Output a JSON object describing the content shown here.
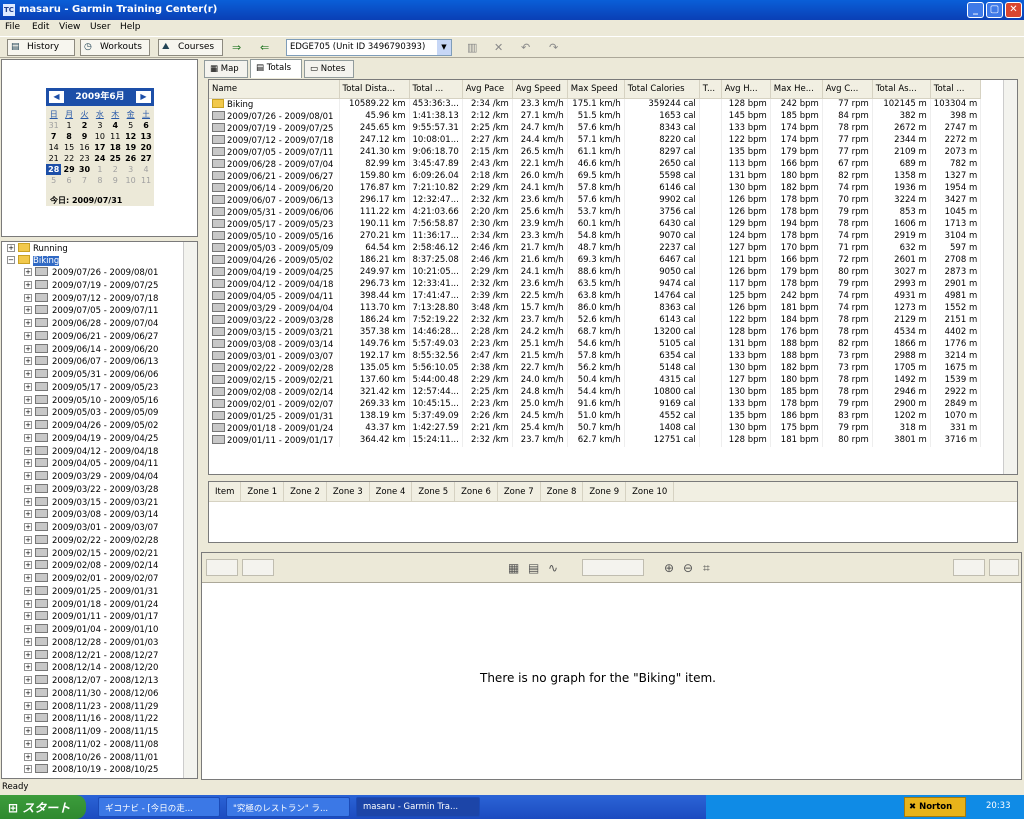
{
  "window": {
    "title": "masaru - Garmin Training Center(r)",
    "icon_text": "TC"
  },
  "menu": [
    "File",
    "Edit",
    "View",
    "User",
    "Help"
  ],
  "toolbar": {
    "history": "History",
    "workouts": "Workouts",
    "courses": "Courses",
    "device": "EDGE705 (Unit ID 3496790393)"
  },
  "calendar": {
    "month": "2009年6月",
    "weekdays": [
      "日",
      "月",
      "火",
      "水",
      "木",
      "金",
      "土"
    ],
    "weeks": [
      [
        "31",
        "1",
        "2",
        "3",
        "4",
        "5",
        "6"
      ],
      [
        "7",
        "8",
        "9",
        "10",
        "11",
        "12",
        "13"
      ],
      [
        "14",
        "15",
        "16",
        "17",
        "18",
        "19",
        "20"
      ],
      [
        "21",
        "22",
        "23",
        "24",
        "25",
        "26",
        "27"
      ],
      [
        "28",
        "29",
        "30",
        "1",
        "2",
        "3",
        "4"
      ],
      [
        "5",
        "6",
        "7",
        "8",
        "9",
        "10",
        "11"
      ]
    ],
    "today_label": "今日: 2009/07/31"
  },
  "tree": {
    "running": "Running",
    "biking": "Biking",
    "weeks": [
      "2009/07/26 - 2009/08/01",
      "2009/07/19 - 2009/07/25",
      "2009/07/12 - 2009/07/18",
      "2009/07/05 - 2009/07/11",
      "2009/06/28 - 2009/07/04",
      "2009/06/21 - 2009/06/27",
      "2009/06/14 - 2009/06/20",
      "2009/06/07 - 2009/06/13",
      "2009/05/31 - 2009/06/06",
      "2009/05/17 - 2009/05/23",
      "2009/05/10 - 2009/05/16",
      "2009/05/03 - 2009/05/09",
      "2009/04/26 - 2009/05/02",
      "2009/04/19 - 2009/04/25",
      "2009/04/12 - 2009/04/18",
      "2009/04/05 - 2009/04/11",
      "2009/03/29 - 2009/04/04",
      "2009/03/22 - 2009/03/28",
      "2009/03/15 - 2009/03/21",
      "2009/03/08 - 2009/03/14",
      "2009/03/01 - 2009/03/07",
      "2009/02/22 - 2009/02/28",
      "2009/02/15 - 2009/02/21",
      "2009/02/08 - 2009/02/14",
      "2009/02/01 - 2009/02/07",
      "2009/01/25 - 2009/01/31",
      "2009/01/18 - 2009/01/24",
      "2009/01/11 - 2009/01/17",
      "2009/01/04 - 2009/01/10",
      "2008/12/28 - 2009/01/03",
      "2008/12/21 - 2008/12/27",
      "2008/12/14 - 2008/12/20",
      "2008/12/07 - 2008/12/13",
      "2008/11/30 - 2008/12/06",
      "2008/11/23 - 2008/11/29",
      "2008/11/16 - 2008/11/22",
      "2008/11/09 - 2008/11/15",
      "2008/11/02 - 2008/11/08",
      "2008/10/26 - 2008/11/01",
      "2008/10/19 - 2008/10/25"
    ]
  },
  "tabs": [
    "Map",
    "Totals",
    "Notes"
  ],
  "table": {
    "headers": [
      "Name",
      "Total Dista...",
      "Total ...",
      "Avg Pace",
      "Avg Speed",
      "Max Speed",
      "Total Calories",
      "T...",
      "Avg H...",
      "Max He...",
      "Avg C...",
      "Total As...",
      "Total ..."
    ],
    "rows": [
      [
        "Biking",
        "10589.22 km",
        "453:36:3...",
        "2:34 /km",
        "23.3 km/h",
        "175.1 km/h",
        "359244 cal",
        "",
        "128 bpm",
        "242 bpm",
        "77 rpm",
        "102145 m",
        "103304 m"
      ],
      [
        "2009/07/26 - 2009/08/01",
        "45.96 km",
        "1:41:38.13",
        "2:12 /km",
        "27.1 km/h",
        "51.5 km/h",
        "1653 cal",
        "",
        "145 bpm",
        "185 bpm",
        "84 rpm",
        "382 m",
        "398 m"
      ],
      [
        "2009/07/19 - 2009/07/25",
        "245.65 km",
        "9:55:57.31",
        "2:25 /km",
        "24.7 km/h",
        "57.6 km/h",
        "8343 cal",
        "",
        "133 bpm",
        "174 bpm",
        "78 rpm",
        "2672 m",
        "2747 m"
      ],
      [
        "2009/07/12 - 2009/07/18",
        "247.12 km",
        "10:08:01...",
        "2:27 /km",
        "24.4 km/h",
        "57.1 km/h",
        "8220 cal",
        "",
        "122 bpm",
        "174 bpm",
        "77 rpm",
        "2344 m",
        "2272 m"
      ],
      [
        "2009/07/05 - 2009/07/11",
        "241.30 km",
        "9:06:18.70",
        "2:15 /km",
        "26.5 km/h",
        "61.1 km/h",
        "8297 cal",
        "",
        "135 bpm",
        "179 bpm",
        "77 rpm",
        "2109 m",
        "2073 m"
      ],
      [
        "2009/06/28 - 2009/07/04",
        "82.99 km",
        "3:45:47.89",
        "2:43 /km",
        "22.1 km/h",
        "46.6 km/h",
        "2650 cal",
        "",
        "113 bpm",
        "166 bpm",
        "67 rpm",
        "689 m",
        "782 m"
      ],
      [
        "2009/06/21 - 2009/06/27",
        "159.80 km",
        "6:09:26.04",
        "2:18 /km",
        "26.0 km/h",
        "69.5 km/h",
        "5598 cal",
        "",
        "131 bpm",
        "180 bpm",
        "82 rpm",
        "1358 m",
        "1327 m"
      ],
      [
        "2009/06/14 - 2009/06/20",
        "176.87 km",
        "7:21:10.82",
        "2:29 /km",
        "24.1 km/h",
        "57.8 km/h",
        "6146 cal",
        "",
        "130 bpm",
        "182 bpm",
        "74 rpm",
        "1936 m",
        "1954 m"
      ],
      [
        "2009/06/07 - 2009/06/13",
        "296.17 km",
        "12:32:47...",
        "2:32 /km",
        "23.6 km/h",
        "57.6 km/h",
        "9902 cal",
        "",
        "126 bpm",
        "178 bpm",
        "70 rpm",
        "3224 m",
        "3427 m"
      ],
      [
        "2009/05/31 - 2009/06/06",
        "111.22 km",
        "4:21:03.66",
        "2:20 /km",
        "25.6 km/h",
        "53.7 km/h",
        "3756 cal",
        "",
        "126 bpm",
        "178 bpm",
        "79 rpm",
        "853 m",
        "1045 m"
      ],
      [
        "2009/05/17 - 2009/05/23",
        "190.11 km",
        "7:56:58.87",
        "2:30 /km",
        "23.9 km/h",
        "60.1 km/h",
        "6430 cal",
        "",
        "129 bpm",
        "194 bpm",
        "78 rpm",
        "1606 m",
        "1713 m"
      ],
      [
        "2009/05/10 - 2009/05/16",
        "270.21 km",
        "11:36:17...",
        "2:34 /km",
        "23.3 km/h",
        "54.8 km/h",
        "9070 cal",
        "",
        "124 bpm",
        "178 bpm",
        "74 rpm",
        "2919 m",
        "3104 m"
      ],
      [
        "2009/05/03 - 2009/05/09",
        "64.54 km",
        "2:58:46.12",
        "2:46 /km",
        "21.7 km/h",
        "48.7 km/h",
        "2237 cal",
        "",
        "127 bpm",
        "170 bpm",
        "71 rpm",
        "632 m",
        "597 m"
      ],
      [
        "2009/04/26 - 2009/05/02",
        "186.21 km",
        "8:37:25.08",
        "2:46 /km",
        "21.6 km/h",
        "69.3 km/h",
        "6467 cal",
        "",
        "121 bpm",
        "166 bpm",
        "72 rpm",
        "2601 m",
        "2708 m"
      ],
      [
        "2009/04/19 - 2009/04/25",
        "249.97 km",
        "10:21:05...",
        "2:29 /km",
        "24.1 km/h",
        "88.6 km/h",
        "9050 cal",
        "",
        "126 bpm",
        "179 bpm",
        "80 rpm",
        "3027 m",
        "2873 m"
      ],
      [
        "2009/04/12 - 2009/04/18",
        "296.73 km",
        "12:33:41...",
        "2:32 /km",
        "23.6 km/h",
        "63.5 km/h",
        "9474 cal",
        "",
        "117 bpm",
        "178 bpm",
        "79 rpm",
        "2993 m",
        "2901 m"
      ],
      [
        "2009/04/05 - 2009/04/11",
        "398.44 km",
        "17:41:47...",
        "2:39 /km",
        "22.5 km/h",
        "63.8 km/h",
        "14764 cal",
        "",
        "125 bpm",
        "242 bpm",
        "74 rpm",
        "4931 m",
        "4981 m"
      ],
      [
        "2009/03/29 - 2009/04/04",
        "113.70 km",
        "7:13:28.80",
        "3:48 /km",
        "15.7 km/h",
        "86.0 km/h",
        "8363 cal",
        "",
        "126 bpm",
        "181 bpm",
        "74 rpm",
        "1273 m",
        "1552 m"
      ],
      [
        "2009/03/22 - 2009/03/28",
        "186.24 km",
        "7:52:19.22",
        "2:32 /km",
        "23.7 km/h",
        "52.6 km/h",
        "6143 cal",
        "",
        "122 bpm",
        "184 bpm",
        "78 rpm",
        "2129 m",
        "2151 m"
      ],
      [
        "2009/03/15 - 2009/03/21",
        "357.38 km",
        "14:46:28...",
        "2:28 /km",
        "24.2 km/h",
        "68.7 km/h",
        "13200 cal",
        "",
        "128 bpm",
        "176 bpm",
        "78 rpm",
        "4534 m",
        "4402 m"
      ],
      [
        "2009/03/08 - 2009/03/14",
        "149.76 km",
        "5:57:49.03",
        "2:23 /km",
        "25.1 km/h",
        "54.6 km/h",
        "5105 cal",
        "",
        "131 bpm",
        "188 bpm",
        "82 rpm",
        "1866 m",
        "1776 m"
      ],
      [
        "2009/03/01 - 2009/03/07",
        "192.17 km",
        "8:55:32.56",
        "2:47 /km",
        "21.5 km/h",
        "57.8 km/h",
        "6354 cal",
        "",
        "133 bpm",
        "188 bpm",
        "73 rpm",
        "2988 m",
        "3214 m"
      ],
      [
        "2009/02/22 - 2009/02/28",
        "135.05 km",
        "5:56:10.05",
        "2:38 /km",
        "22.7 km/h",
        "56.2 km/h",
        "5148 cal",
        "",
        "130 bpm",
        "182 bpm",
        "73 rpm",
        "1705 m",
        "1675 m"
      ],
      [
        "2009/02/15 - 2009/02/21",
        "137.60 km",
        "5:44:00.48",
        "2:29 /km",
        "24.0 km/h",
        "50.4 km/h",
        "4315 cal",
        "",
        "127 bpm",
        "180 bpm",
        "78 rpm",
        "1492 m",
        "1539 m"
      ],
      [
        "2009/02/08 - 2009/02/14",
        "321.42 km",
        "12:57:44...",
        "2:25 /km",
        "24.8 km/h",
        "54.4 km/h",
        "10800 cal",
        "",
        "130 bpm",
        "185 bpm",
        "78 rpm",
        "2946 m",
        "2922 m"
      ],
      [
        "2009/02/01 - 2009/02/07",
        "269.33 km",
        "10:45:15...",
        "2:23 /km",
        "25.0 km/h",
        "91.6 km/h",
        "9169 cal",
        "",
        "133 bpm",
        "178 bpm",
        "79 rpm",
        "2900 m",
        "2849 m"
      ],
      [
        "2009/01/25 - 2009/01/31",
        "138.19 km",
        "5:37:49.09",
        "2:26 /km",
        "24.5 km/h",
        "51.0 km/h",
        "4552 cal",
        "",
        "135 bpm",
        "186 bpm",
        "83 rpm",
        "1202 m",
        "1070 m"
      ],
      [
        "2009/01/18 - 2009/01/24",
        "43.37 km",
        "1:42:27.59",
        "2:21 /km",
        "25.4 km/h",
        "50.7 km/h",
        "1408 cal",
        "",
        "130 bpm",
        "175 bpm",
        "79 rpm",
        "318 m",
        "331 m"
      ],
      [
        "2009/01/11 - 2009/01/17",
        "364.42 km",
        "15:24:11...",
        "2:32 /km",
        "23.7 km/h",
        "62.7 km/h",
        "12751 cal",
        "",
        "128 bpm",
        "181 bpm",
        "80 rpm",
        "3801 m",
        "3716 m"
      ]
    ]
  },
  "zones": {
    "headers": [
      "Item",
      "Zone 1",
      "Zone 2",
      "Zone 3",
      "Zone 4",
      "Zone 5",
      "Zone 6",
      "Zone 7",
      "Zone 8",
      "Zone 9",
      "Zone 10"
    ]
  },
  "graph": {
    "message": "There is no graph for the \"Biking\" item."
  },
  "status": "Ready",
  "taskbar": {
    "start": "スタート",
    "tasks": [
      "ギコナビ - [今日の走...",
      "\"究極のレストラン\" ラ...",
      "masaru - Garmin Tra..."
    ],
    "norton": "Norton",
    "clock": "20:33"
  }
}
